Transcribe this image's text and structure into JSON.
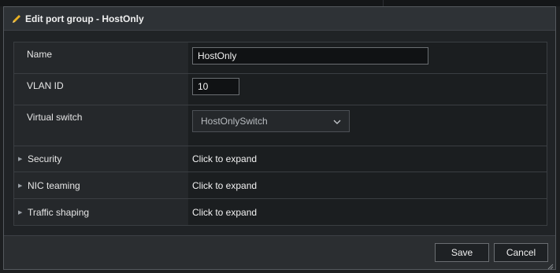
{
  "dialog": {
    "title": "Edit port group - HostOnly",
    "icon": "pencil-icon"
  },
  "fields": {
    "name": {
      "label": "Name",
      "value": "HostOnly"
    },
    "vlan": {
      "label": "VLAN ID",
      "value": "10"
    },
    "virtual_switch": {
      "label": "Virtual switch",
      "value": "HostOnlySwitch"
    }
  },
  "sections": [
    {
      "label": "Security",
      "action": "Click to expand"
    },
    {
      "label": "NIC teaming",
      "action": "Click to expand"
    },
    {
      "label": "Traffic shaping",
      "action": "Click to expand"
    }
  ],
  "buttons": {
    "save": "Save",
    "cancel": "Cancel"
  },
  "colors": {
    "accent_pencil": "#e8b023",
    "background": "#1d1f21",
    "panel": "#2b2e31"
  }
}
